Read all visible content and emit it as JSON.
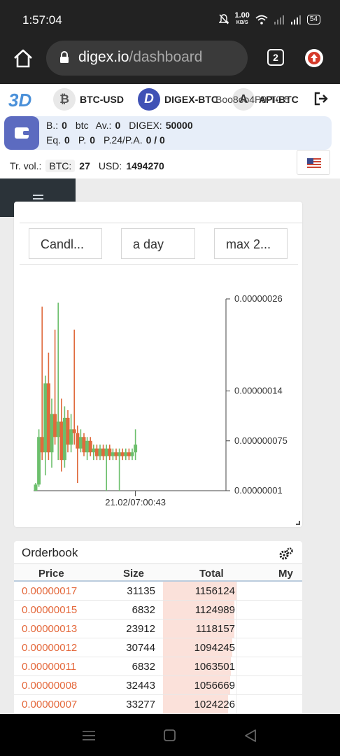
{
  "status_bar": {
    "time": "1:57:04",
    "net_speed": "1.00",
    "net_unit": "KB/S",
    "battery": "54"
  },
  "browser": {
    "url_host": "digex.io",
    "url_path": "/dashboard",
    "tab_count": "2"
  },
  "header": {
    "pairs": [
      {
        "coin_glyph": "₿",
        "label": "BTC-USD"
      },
      {
        "coin_glyph": "D",
        "label": "DIGEX-BTC"
      },
      {
        "coin_glyph": "A",
        "label": "API-BTC"
      }
    ],
    "overlay_text": "Boo8oo4P9-T0.5"
  },
  "account": {
    "b_label": "B.:",
    "b_value": "0",
    "b_unit": "btc",
    "av_label": "Av.:",
    "av_value": "0",
    "digex_label": "DIGEX:",
    "digex_value": "50000",
    "eq_label": "Eq.",
    "eq_value": "0",
    "p_label": "P.",
    "p_value": "0",
    "p24_label": "P.24/P.A.",
    "p24_value": "0 / 0"
  },
  "trade_volume": {
    "label": "Tr. vol.:",
    "btc_label": "BTC:",
    "btc_value": "27",
    "usd_label": "USD:",
    "usd_value": "1494270"
  },
  "chart_controls": {
    "type": "Candl...",
    "interval": "a day",
    "range": "max 2..."
  },
  "chart_data": {
    "type": "candlestick",
    "title": "",
    "x_tick_labels": [
      "21.02/07:00:43"
    ],
    "y_tick_labels": [
      "0.00000026",
      "0.00000014",
      "0.000000075",
      "0.00000001"
    ],
    "y_tick_values": [
      2.6e-07,
      1.4e-07,
      7.5e-08,
      1e-08
    ],
    "ylim": [
      1e-08,
      2.6e-07
    ],
    "colors": {
      "up": "#6cbf6c",
      "down": "#e06a3c"
    },
    "candles": [
      {
        "o": 1e-08,
        "h": 2e-08,
        "l": 1e-08,
        "c": 1.8e-08
      },
      {
        "o": 1.8e-08,
        "h": 9e-08,
        "l": 1.5e-08,
        "c": 8e-08
      },
      {
        "o": 8e-08,
        "h": 2.5e-07,
        "l": 5e-08,
        "c": 6e-08
      },
      {
        "o": 6e-08,
        "h": 1.6e-07,
        "l": 3e-08,
        "c": 1.5e-07
      },
      {
        "o": 1.5e-07,
        "h": 1.9e-07,
        "l": 5e-08,
        "c": 6e-08
      },
      {
        "o": 6e-08,
        "h": 1.3e-07,
        "l": 4e-08,
        "c": 1.1e-07
      },
      {
        "o": 1.1e-07,
        "h": 2.2e-07,
        "l": 7e-08,
        "c": 8e-08
      },
      {
        "o": 8e-08,
        "h": 2.55e-07,
        "l": 5e-08,
        "c": 1e-07
      },
      {
        "o": 1e-07,
        "h": 1.3e-07,
        "l": 3.5e-08,
        "c": 5e-08
      },
      {
        "o": 5e-08,
        "h": 1.2e-07,
        "l": 4e-08,
        "c": 1.05e-07
      },
      {
        "o": 1.05e-07,
        "h": 1.15e-07,
        "l": 6e-08,
        "c": 7e-08
      },
      {
        "o": 7e-08,
        "h": 1.1e-07,
        "l": 6e-08,
        "c": 9e-08
      },
      {
        "o": 9e-08,
        "h": 2.2e-07,
        "l": 7e-08,
        "c": 8.5e-08
      },
      {
        "o": 8.5e-08,
        "h": 9.5e-08,
        "l": 2e-08,
        "c": 6.5e-08
      },
      {
        "o": 6.5e-08,
        "h": 9e-08,
        "l": 6e-08,
        "c": 8e-08
      },
      {
        "o": 8e-08,
        "h": 8.5e-08,
        "l": 5.5e-08,
        "c": 6e-08
      },
      {
        "o": 6e-08,
        "h": 8e-08,
        "l": 5e-08,
        "c": 7.5e-08
      },
      {
        "o": 7.5e-08,
        "h": 8e-08,
        "l": 5.5e-08,
        "c": 6e-08
      },
      {
        "o": 6e-08,
        "h": 7e-08,
        "l": 5e-08,
        "c": 6.5e-08
      },
      {
        "o": 6.5e-08,
        "h": 7e-08,
        "l": 5e-08,
        "c": 5.5e-08
      },
      {
        "o": 5.5e-08,
        "h": 7e-08,
        "l": 5e-08,
        "c": 6.5e-08
      },
      {
        "o": 6.5e-08,
        "h": 7e-08,
        "l": 5e-08,
        "c": 5.5e-08
      },
      {
        "o": 5.5e-08,
        "h": 7e-08,
        "l": 1e-08,
        "c": 6.5e-08
      },
      {
        "o": 6.5e-08,
        "h": 7e-08,
        "l": 5e-08,
        "c": 5.5e-08
      },
      {
        "o": 5.5e-08,
        "h": 6.5e-08,
        "l": 5e-08,
        "c": 6e-08
      },
      {
        "o": 6e-08,
        "h": 6.5e-08,
        "l": 5e-08,
        "c": 5.5e-08
      },
      {
        "o": 5.5e-08,
        "h": 6.5e-08,
        "l": 1e-08,
        "c": 6e-08
      },
      {
        "o": 6e-08,
        "h": 6.5e-08,
        "l": 5e-08,
        "c": 5.5e-08
      },
      {
        "o": 5.5e-08,
        "h": 6.5e-08,
        "l": 5e-08,
        "c": 6e-08
      },
      {
        "o": 6e-08,
        "h": 6.5e-08,
        "l": 5e-08,
        "c": 5.5e-08
      },
      {
        "o": 5.5e-08,
        "h": 6.5e-08,
        "l": 5e-08,
        "c": 6e-08
      },
      {
        "o": 6e-08,
        "h": 9e-08,
        "l": 5e-08,
        "c": 7e-08
      }
    ]
  },
  "orderbook": {
    "title": "Orderbook",
    "columns": [
      "Price",
      "Size",
      "Total",
      "My"
    ],
    "max_total": 1156124,
    "rows": [
      {
        "price": "0.00000017",
        "size": "31135",
        "total": "1156124",
        "total_num": 1156124
      },
      {
        "price": "0.00000015",
        "size": "6832",
        "total": "1124989",
        "total_num": 1124989
      },
      {
        "price": "0.00000013",
        "size": "23912",
        "total": "1118157",
        "total_num": 1118157
      },
      {
        "price": "0.00000012",
        "size": "30744",
        "total": "1094245",
        "total_num": 1094245
      },
      {
        "price": "0.00000011",
        "size": "6832",
        "total": "1063501",
        "total_num": 1063501
      },
      {
        "price": "0.00000008",
        "size": "32443",
        "total": "1056669",
        "total_num": 1056669
      },
      {
        "price": "0.00000007",
        "size": "33277",
        "total": "1024226",
        "total_num": 1024226
      }
    ]
  }
}
